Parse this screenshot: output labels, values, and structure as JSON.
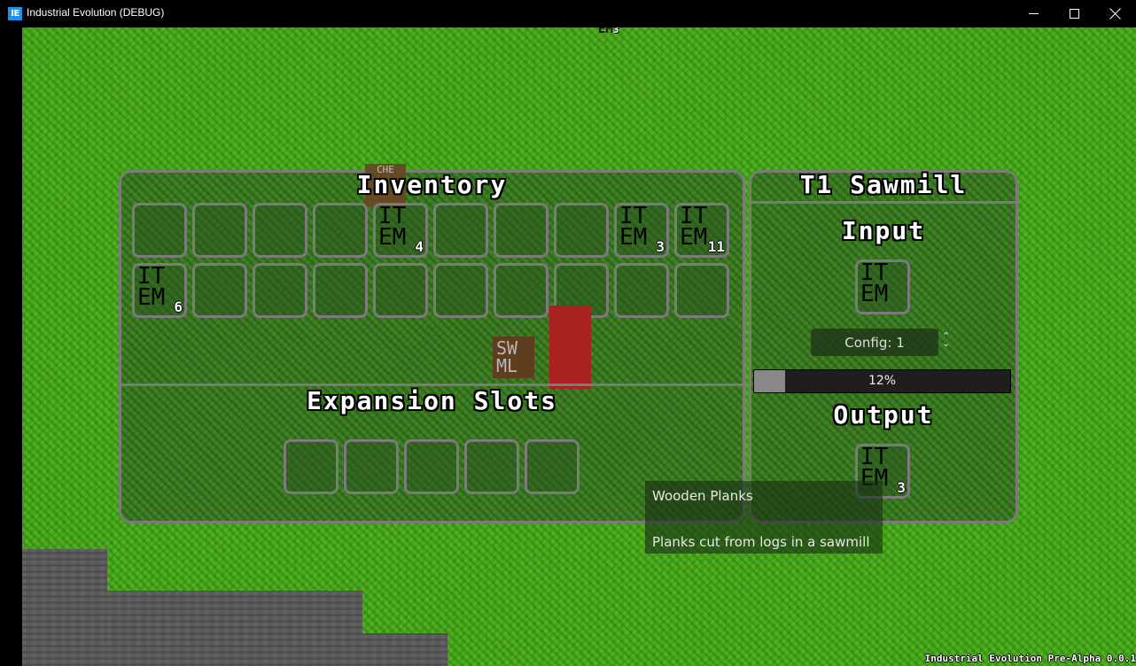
{
  "window": {
    "icon_text": "IE",
    "title": "Industrial Evolution (DEBUG)",
    "controls": [
      "minimize",
      "maximize",
      "close"
    ]
  },
  "world": {
    "dropped_item_count": "3",
    "chest_label": "CHE",
    "placed_block_label_line1": "SW",
    "placed_block_label_line2": "ML",
    "version": "Industrial Evolution Pre-Alpha 0.0.1"
  },
  "inventory": {
    "title": "Inventory",
    "slots": [
      {
        "item": "",
        "count": ""
      },
      {
        "item": "",
        "count": ""
      },
      {
        "item": "",
        "count": ""
      },
      {
        "item": "",
        "count": ""
      },
      {
        "item": "ITEM",
        "count": "4"
      },
      {
        "item": "",
        "count": ""
      },
      {
        "item": "",
        "count": ""
      },
      {
        "item": "",
        "count": ""
      },
      {
        "item": "ITEM",
        "count": "3"
      },
      {
        "item": "ITEM",
        "count": "11"
      },
      {
        "item": "ITEM",
        "count": "6"
      },
      {
        "item": "",
        "count": ""
      },
      {
        "item": "",
        "count": ""
      },
      {
        "item": "",
        "count": ""
      },
      {
        "item": "",
        "count": ""
      },
      {
        "item": "",
        "count": ""
      },
      {
        "item": "",
        "count": ""
      },
      {
        "item": "",
        "count": ""
      },
      {
        "item": "",
        "count": ""
      },
      {
        "item": "",
        "count": ""
      }
    ]
  },
  "expansion": {
    "title": "Expansion Slots",
    "slots": [
      {
        "item": "",
        "count": ""
      },
      {
        "item": "",
        "count": ""
      },
      {
        "item": "",
        "count": ""
      },
      {
        "item": "",
        "count": ""
      },
      {
        "item": "",
        "count": ""
      }
    ]
  },
  "machine": {
    "title": "T1 Sawmill",
    "input_label": "Input",
    "input_slot": {
      "item": "ITEM",
      "count": ""
    },
    "config_label": "Config: 1",
    "progress_percent": 12,
    "progress_text": "12%",
    "output_label": "Output",
    "output_slot": {
      "item": "ITEM",
      "count": "3"
    }
  },
  "tooltip": {
    "name": "Wooden Planks",
    "description": "Planks cut from logs in a sawmill"
  },
  "colors": {
    "app_icon": "#1e90e8",
    "panel_border": "#7b7b7b",
    "red_bar": "#a82222",
    "progress_fill": "#888888"
  }
}
